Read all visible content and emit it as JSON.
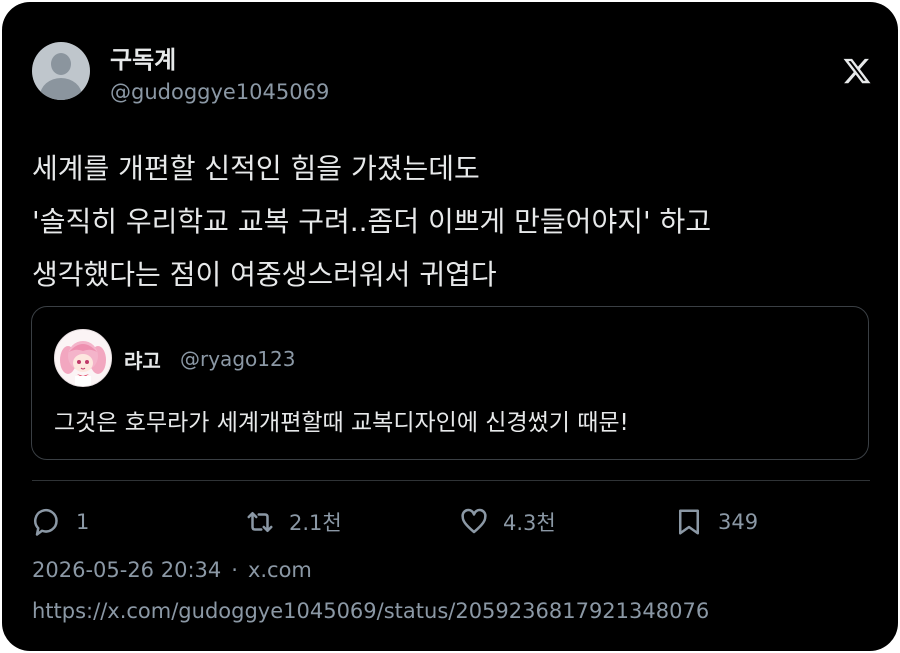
{
  "author": {
    "display_name": "구독계",
    "handle": "@gudoggye1045069"
  },
  "brand_icon": "x-logo-icon",
  "tweet": {
    "lines": [
      "세계를 개편할 신적인 힘을 가졌는데도",
      "'솔직히 우리학교 교복 구려..좀더 이쁘게 만들어야지' 하고",
      "생각했다는 점이 여중생스러워서 귀엽다"
    ]
  },
  "quoted_tweet": {
    "display_name": "랴고",
    "handle": "@ryago123",
    "text": "그것은 호무라가 세계개편할때 교복디자인에 신경썼기 때문!"
  },
  "actions": {
    "reply_count": "1",
    "retweet_count": "2.1천",
    "like_count": "4.3천",
    "bookmark_count": "349"
  },
  "meta": {
    "timestamp": "2026-05-26 20:34",
    "separator": "·",
    "source": "x.com"
  },
  "url": "https://x.com/gudoggye1045069/status/2059236817921348076",
  "colors": {
    "background": "#000000",
    "text": "#e7e9ea",
    "secondary_text": "#8b98a5",
    "border": "#2f3336"
  }
}
